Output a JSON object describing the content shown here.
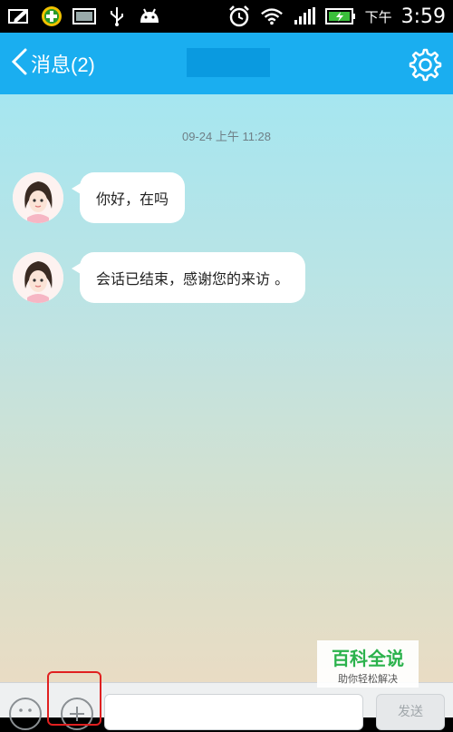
{
  "status_bar": {
    "left_icons": [
      "edit-box-icon",
      "battery-saver-app-icon",
      "image-icon",
      "usb-icon",
      "android-icon"
    ],
    "right_icons": [
      "alarm-clock-icon",
      "wifi-icon",
      "signal-icon",
      "charging-battery-icon"
    ],
    "ampm": "下午",
    "time": "3:59"
  },
  "header": {
    "back_label": "消息(2)",
    "accent_color": "#1aaef0"
  },
  "chat": {
    "timestamp": "09-24 上午 11:28",
    "messages": [
      {
        "text": "你好，在吗"
      },
      {
        "text": "会话已结束，感谢您的来访 。"
      }
    ]
  },
  "input_bar": {
    "send_label": "发送"
  },
  "watermark": {
    "title": "百科全说",
    "subtitle": "助你轻松解决"
  }
}
